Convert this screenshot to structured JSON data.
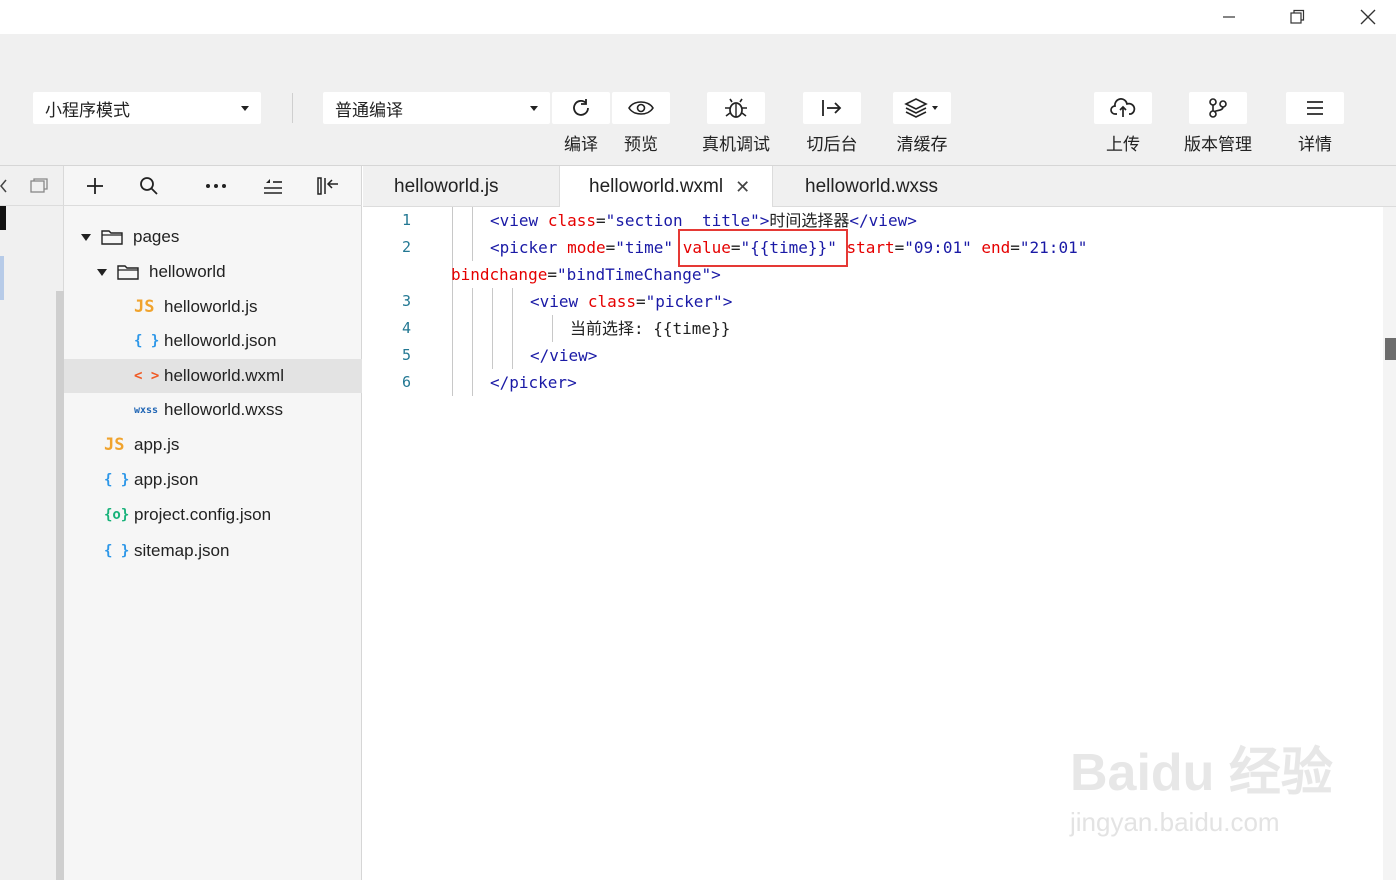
{
  "toolbar": {
    "mode_select": "小程序模式",
    "compile_select": "普通编译",
    "buttons": {
      "compile": "编译",
      "preview": "预览",
      "remote_debug": "真机调试",
      "background": "切后台",
      "clear_cache": "清缓存",
      "upload": "上传",
      "version": "版本管理",
      "details": "详情"
    }
  },
  "explorer": {
    "items": [
      {
        "label": "pages",
        "type": "folder"
      },
      {
        "label": "helloworld",
        "type": "folder"
      },
      {
        "label": "helloworld.js",
        "icon": "JS"
      },
      {
        "label": "helloworld.json",
        "icon": "{ }"
      },
      {
        "label": "helloworld.wxml",
        "icon": "< >"
      },
      {
        "label": "helloworld.wxss",
        "icon": "wxss"
      },
      {
        "label": "app.js",
        "icon": "JS"
      },
      {
        "label": "app.json",
        "icon": "{ }"
      },
      {
        "label": "project.config.json",
        "icon": "{o}"
      },
      {
        "label": "sitemap.json",
        "icon": "{ }"
      }
    ]
  },
  "tabs": [
    {
      "label": "helloworld.js"
    },
    {
      "label": "helloworld.wxml",
      "active": true
    },
    {
      "label": "helloworld.wxss"
    }
  ],
  "editor": {
    "line_numbers": [
      "1",
      "2",
      "3",
      "4",
      "5",
      "6"
    ],
    "line1": {
      "open": "<view",
      "attr": "class",
      "eq": "=",
      "val": "\"section__title\"",
      "close": ">",
      "text": "时间选择器",
      "end": "</view>"
    },
    "line2": {
      "open": "<picker",
      "attr1": "mode",
      "val1": "\"time\"",
      "attr2": "value",
      "val2": "\"{{time}}\"",
      "attr3": "start",
      "val3": "\"09:01\"",
      "attr4": "end",
      "val4": "\"21:01\""
    },
    "line2_wrap": {
      "attr": "bindchange",
      "val": "\"bindTimeChange\"",
      "close": ">"
    },
    "line3": {
      "open": "<view",
      "attr": "class",
      "val": "\"picker\"",
      "close": ">"
    },
    "line4": {
      "text": "当前选择: {{time}}"
    },
    "line5": {
      "end": "</view>"
    },
    "line6": {
      "end": "</picker>"
    }
  },
  "watermark": {
    "brand": "Baidu 经验",
    "url": "jingyan.baidu.com"
  }
}
